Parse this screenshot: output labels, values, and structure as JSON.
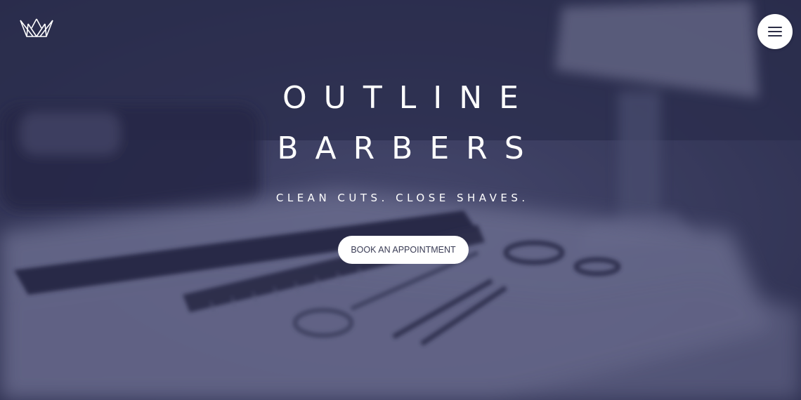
{
  "header": {
    "logo_icon": "crown-outline-icon",
    "menu_icon": "hamburger-menu-icon"
  },
  "hero": {
    "title_line_1": "OUTLINE",
    "title_line_2": "BARBERS",
    "tagline": "CLEAN CUTS. CLOSE SHAVES.",
    "cta_label": "BOOK AN APPOINTMENT",
    "background_subject": "barber-tools-photo"
  },
  "colors": {
    "overlay": "#2e3050",
    "text": "#ffffff",
    "button_bg": "#ffffff",
    "button_text": "#3a3c55"
  }
}
